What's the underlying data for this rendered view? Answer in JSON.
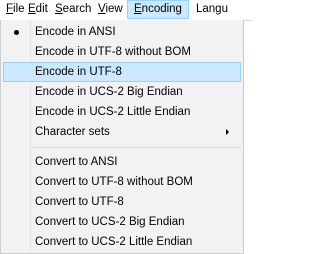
{
  "menubar": {
    "items": [
      {
        "accel": "F",
        "rest": "ile"
      },
      {
        "accel": "E",
        "rest": "dit"
      },
      {
        "accel": "S",
        "rest": "earch"
      },
      {
        "accel": "V",
        "rest": "iew"
      },
      {
        "accel": "E",
        "rest": "ncoding"
      },
      {
        "accel": "",
        "rest": "Langu"
      }
    ]
  },
  "menu": {
    "encode_ansi": "Encode in ANSI",
    "encode_utf8_no_bom": "Encode in UTF-8 without BOM",
    "encode_utf8": "Encode in UTF-8",
    "encode_ucs2_be": "Encode in UCS-2 Big Endian",
    "encode_ucs2_le": "Encode in UCS-2 Little Endian",
    "character_sets": "Character sets",
    "convert_ansi": "Convert to ANSI",
    "convert_utf8_no_bom": "Convert to UTF-8 without BOM",
    "convert_utf8": "Convert to UTF-8",
    "convert_ucs2_be": "Convert to UCS-2 Big Endian",
    "convert_ucs2_le": "Convert to UCS-2 Little Endian"
  }
}
